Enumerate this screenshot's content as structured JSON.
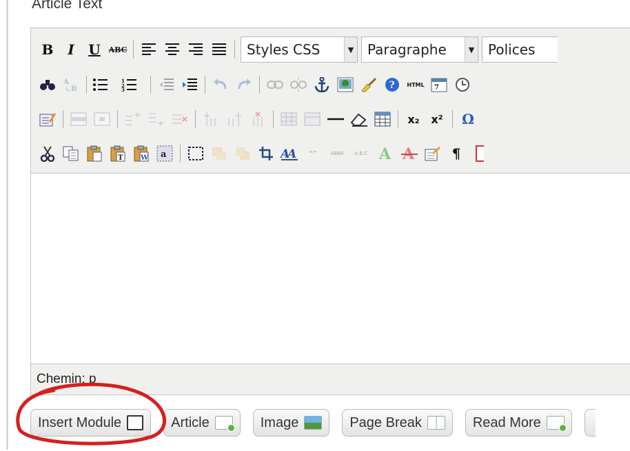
{
  "field_label": "Article Text",
  "toolbar": {
    "row1": {
      "bold": "B",
      "italic": "I",
      "underline": "U",
      "strikethrough": "ABC",
      "styles_select": "Styles CSS",
      "format_select": "Paragraphe",
      "font_select": "Polices"
    },
    "row2": {
      "html": "HTML"
    },
    "row3": {
      "subscript": "x₂",
      "superscript": "x²",
      "omega": "Ω"
    },
    "row4": {
      "cite": "“”",
      "abbr": "ABBR",
      "acronym": "A.B.C.",
      "pilcrow": "¶"
    }
  },
  "statusbar": {
    "path": "Chemin: p"
  },
  "extra_buttons": {
    "insert_module": "Insert Module",
    "article": "Article",
    "image": "Image",
    "page_break": "Page Break",
    "read_more": "Read More"
  },
  "annotation_color": "#d42020"
}
